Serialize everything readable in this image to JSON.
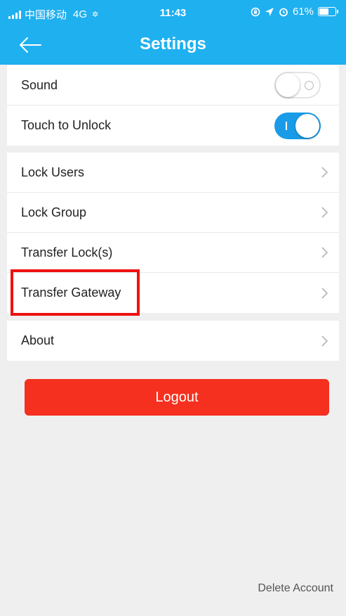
{
  "status_bar": {
    "carrier": "中国移动",
    "network": "4G",
    "time": "11:43",
    "battery": "61%",
    "battery_level": 0.61,
    "icons": [
      "signal-icon",
      "lock-rotation-icon",
      "location-arrow-icon",
      "alarm-icon",
      "battery-icon"
    ]
  },
  "header": {
    "title": "Settings",
    "back_icon": "arrow-left-icon"
  },
  "settings": {
    "sound": {
      "label": "Sound",
      "toggle": "off"
    },
    "touch_unlock": {
      "label": "Touch to Unlock",
      "toggle": "on"
    }
  },
  "menu": {
    "lock_users": "Lock Users",
    "lock_group": "Lock Group",
    "transfer_locks": "Transfer Lock(s)",
    "transfer_gateway": "Transfer Gateway",
    "about": "About",
    "chevron_icon": "chevron-right-icon"
  },
  "actions": {
    "logout": "Logout",
    "delete_account": "Delete Account"
  },
  "colors": {
    "header_bg": "#1fb0f0",
    "toggle_on": "#1a9be8",
    "logout_bg": "#f5301e",
    "highlight_border": "#ee1111",
    "page_bg": "#efefef"
  }
}
